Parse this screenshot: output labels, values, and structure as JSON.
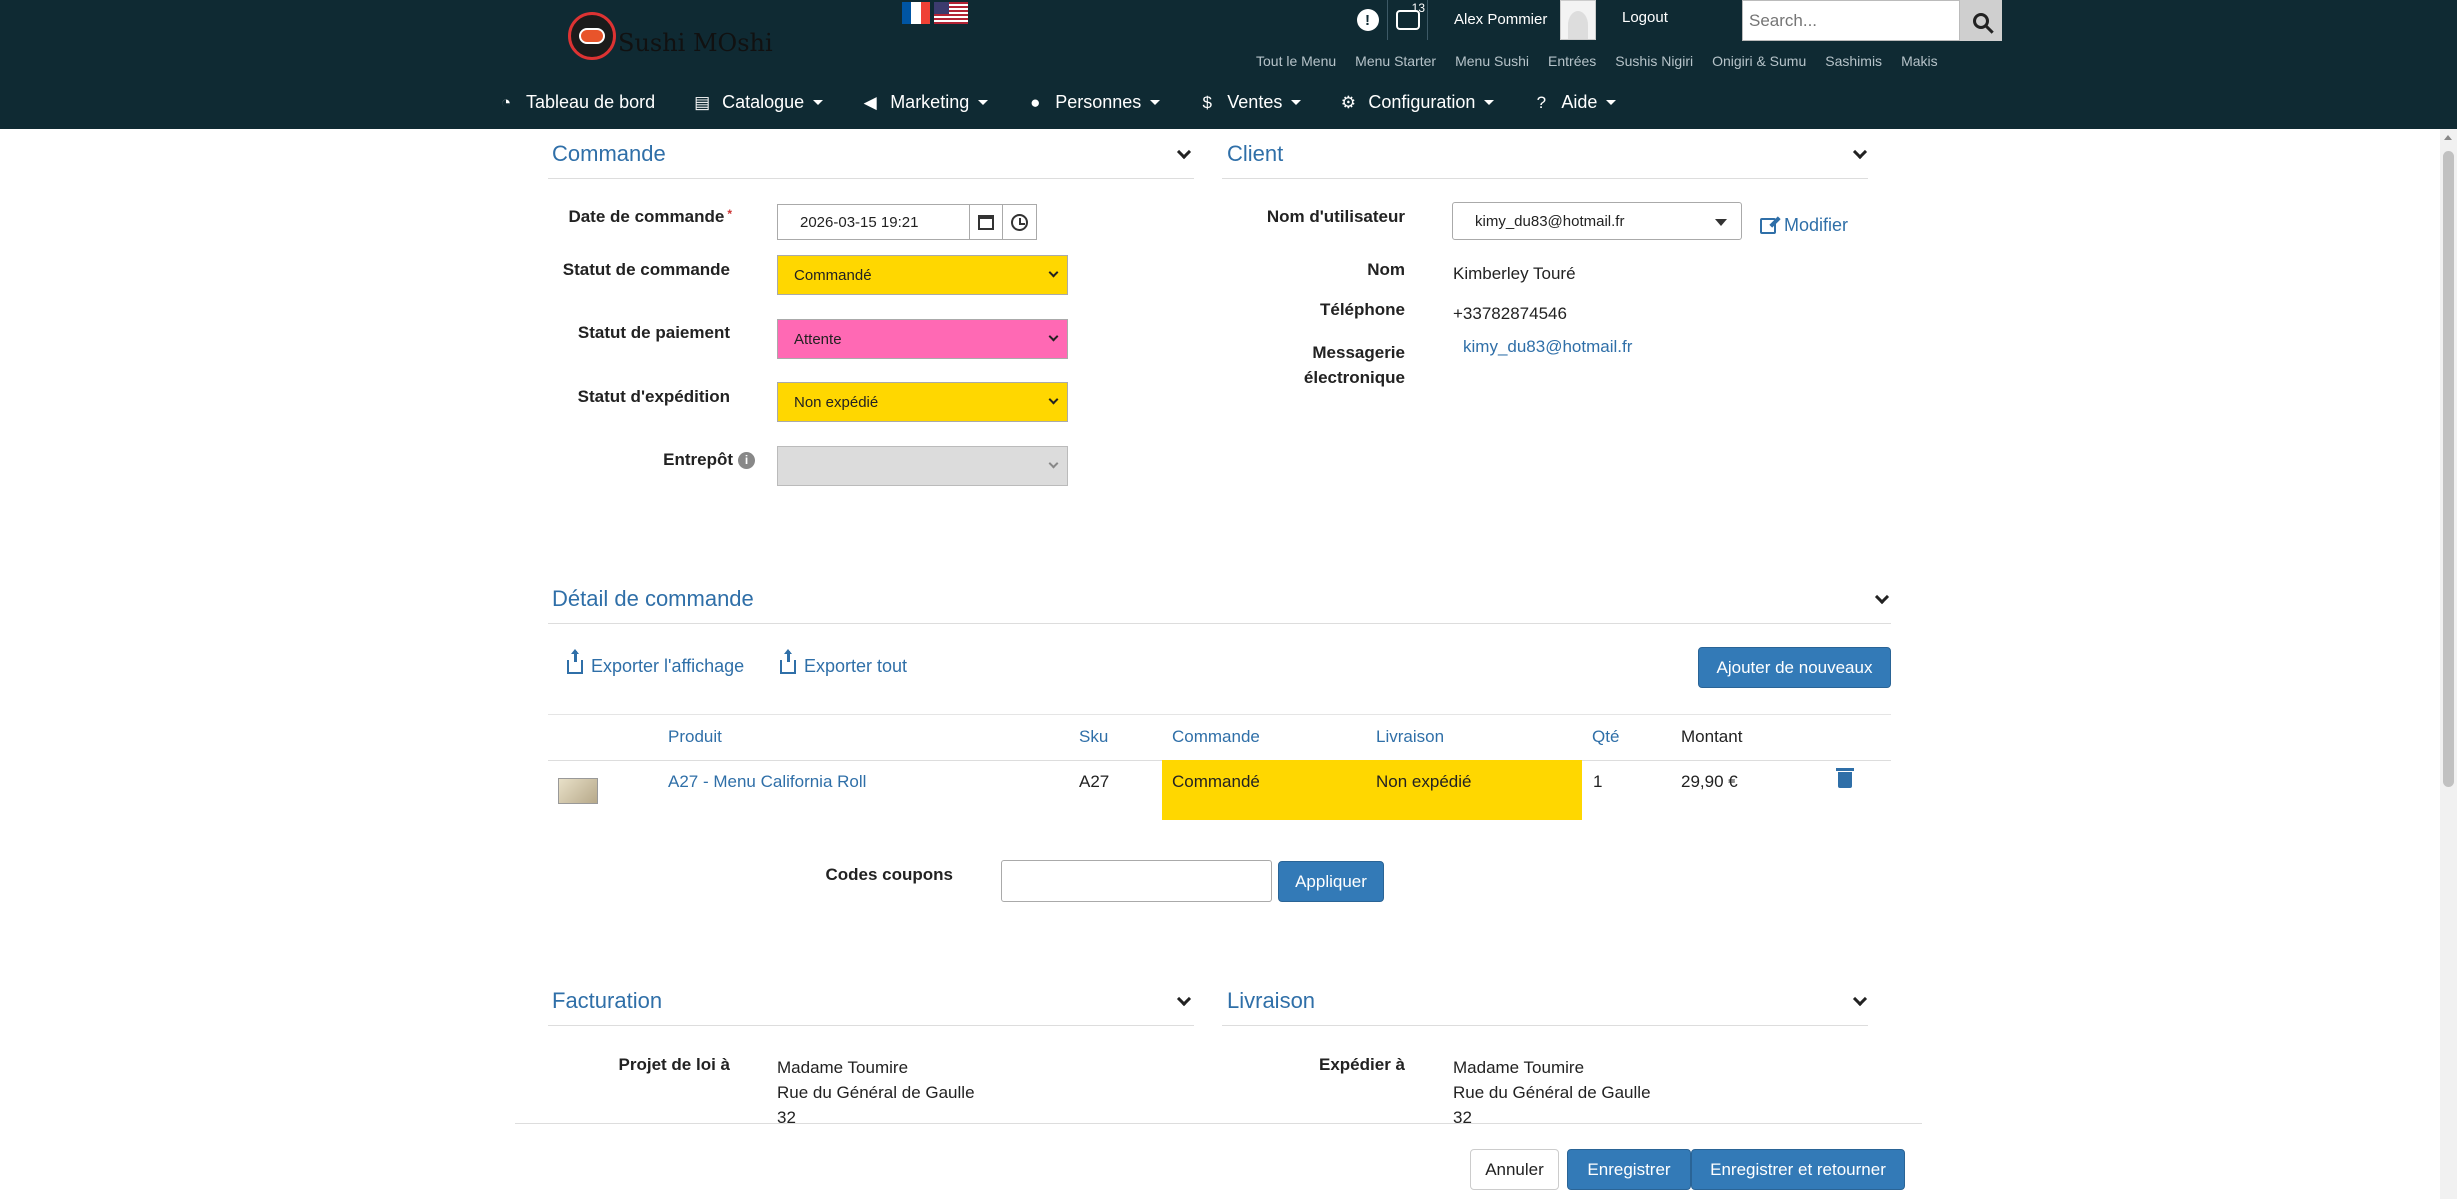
{
  "header": {
    "brand": "Sushi MOshi",
    "notifications_badge": "",
    "messages_badge": "13",
    "username": "Alex Pommier",
    "logout": "Logout",
    "search_placeholder": "Search...",
    "subnav": [
      "Tout le Menu",
      "Menu Starter",
      "Menu Sushi",
      "Entrées",
      "Sushis Nigiri",
      "Onigiri & Sumu",
      "Sashimis",
      "Makis"
    ],
    "mainnav": [
      {
        "label": "Tableau de bord",
        "icon": "dashboard-icon"
      },
      {
        "label": "Catalogue",
        "icon": "book-icon"
      },
      {
        "label": "Marketing",
        "icon": "megaphone-icon"
      },
      {
        "label": "Personnes",
        "icon": "user-icon"
      },
      {
        "label": "Ventes",
        "icon": "dollar-icon"
      },
      {
        "label": "Configuration",
        "icon": "gear-icon"
      },
      {
        "label": "Aide",
        "icon": "question-icon"
      }
    ]
  },
  "order": {
    "title": "Commande",
    "date_label": "Date de commande",
    "date_value": "2026-03-15 19:21",
    "status_label": "Statut de commande",
    "status_value": "Commandé",
    "status_color": "#ffd700",
    "payment_label": "Statut de paiement",
    "payment_value": "Attente",
    "payment_color": "#ff69b4",
    "shipping_label": "Statut d'expédition",
    "shipping_value": "Non expédié",
    "warehouse_label": "Entrepôt",
    "warehouse_value": ""
  },
  "client": {
    "title": "Client",
    "username_label": "Nom d'utilisateur",
    "username_value": "kimy_du83@hotmail.fr",
    "modify": "Modifier",
    "name_label": "Nom",
    "name_value": "Kimberley Touré",
    "phone_label": "Téléphone",
    "phone_value": "+33782874546",
    "email_label_1": "Messagerie",
    "email_label_2": "électronique",
    "email_value": "kimy_du83@hotmail.fr"
  },
  "detail": {
    "title": "Détail de commande",
    "export_view": "Exporter l'affichage",
    "export_all": "Exporter tout",
    "add_new": "Ajouter de nouveaux",
    "columns": {
      "product": "Produit",
      "sku": "Sku",
      "order": "Commande",
      "delivery": "Livraison",
      "qty": "Qté",
      "amount": "Montant"
    },
    "rows": [
      {
        "product": "A27 - Menu California Roll",
        "sku": "A27",
        "order": "Commandé",
        "delivery": "Non expédié",
        "qty": "1",
        "amount": "29,90 €"
      }
    ],
    "coupon_label": "Codes coupons",
    "coupon_value": "",
    "apply": "Appliquer"
  },
  "billing": {
    "title": "Facturation",
    "label": "Projet de loi à",
    "line1": "Madame Toumire",
    "line2": "Rue du Général de Gaulle",
    "line3": "32"
  },
  "delivery": {
    "title": "Livraison",
    "label": "Expédier à",
    "line1": "Madame Toumire",
    "line2": "Rue du Général de Gaulle",
    "line3": "32"
  },
  "footer": {
    "cancel": "Annuler",
    "save": "Enregistrer",
    "save_return": "Enregistrer et retourner"
  }
}
